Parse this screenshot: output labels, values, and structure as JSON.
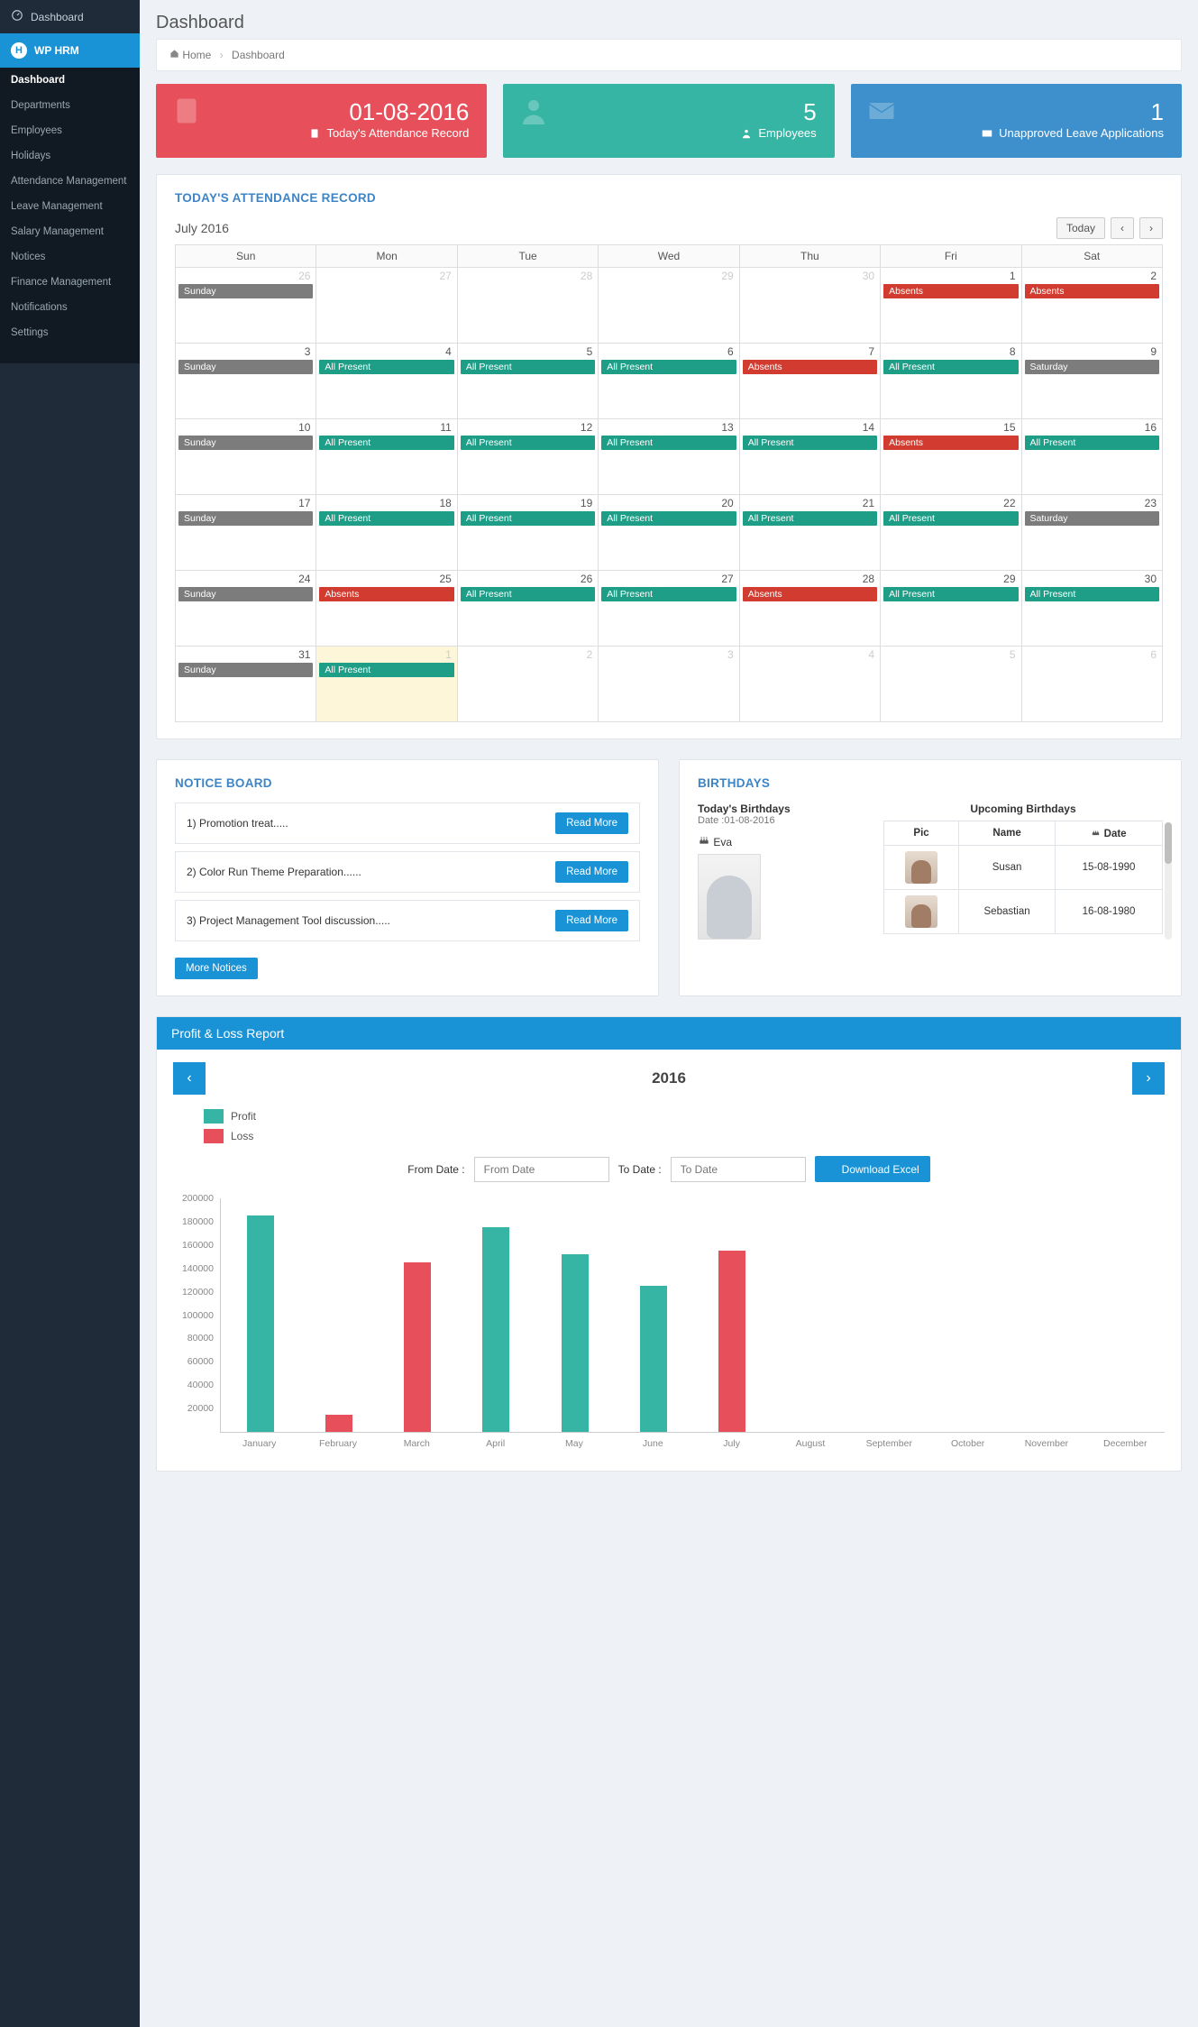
{
  "sidebar": {
    "top_dashboard": "Dashboard",
    "app_name": "WP HRM",
    "nav": [
      "Dashboard",
      "Departments",
      "Employees",
      "Holidays",
      "Attendance Management",
      "Leave Management",
      "Salary Management",
      "Notices",
      "Finance Management",
      "Notifications",
      "Settings"
    ]
  },
  "page": {
    "title": "Dashboard"
  },
  "breadcrumb": {
    "home": "Home",
    "current": "Dashboard"
  },
  "stats": {
    "record": {
      "value": "01-08-2016",
      "label": "Today's Attendance Record"
    },
    "employees": {
      "value": "5",
      "label": "Employees"
    },
    "leave": {
      "value": "1",
      "label": "Unapproved Leave Applications"
    }
  },
  "attendance": {
    "heading": "TODAY'S ATTENDANCE RECORD",
    "month_label": "July 2016",
    "today_btn": "Today",
    "dow": [
      "Sun",
      "Mon",
      "Tue",
      "Wed",
      "Thu",
      "Fri",
      "Sat"
    ],
    "labels": {
      "sunday": "Sunday",
      "saturday": "Saturday",
      "all_present": "All Present",
      "absents": "Absents"
    },
    "weeks": [
      [
        {
          "n": 26,
          "other": true,
          "b": [
            {
              "t": "sunday",
              "c": "grey"
            }
          ]
        },
        {
          "n": 27,
          "other": true
        },
        {
          "n": 28,
          "other": true
        },
        {
          "n": 29,
          "other": true
        },
        {
          "n": 30,
          "other": true
        },
        {
          "n": 1,
          "b": [
            {
              "t": "absents",
              "c": "red"
            }
          ]
        },
        {
          "n": 2,
          "b": [
            {
              "t": "absents",
              "c": "red"
            }
          ]
        }
      ],
      [
        {
          "n": 3,
          "b": [
            {
              "t": "sunday",
              "c": "grey"
            }
          ]
        },
        {
          "n": 4,
          "b": [
            {
              "t": "all_present",
              "c": "green"
            }
          ]
        },
        {
          "n": 5,
          "b": [
            {
              "t": "all_present",
              "c": "green"
            }
          ]
        },
        {
          "n": 6,
          "b": [
            {
              "t": "all_present",
              "c": "green"
            }
          ]
        },
        {
          "n": 7,
          "b": [
            {
              "t": "absents",
              "c": "red"
            }
          ]
        },
        {
          "n": 8,
          "b": [
            {
              "t": "all_present",
              "c": "green"
            }
          ]
        },
        {
          "n": 9,
          "b": [
            {
              "t": "saturday",
              "c": "grey"
            }
          ]
        }
      ],
      [
        {
          "n": 10,
          "b": [
            {
              "t": "sunday",
              "c": "grey"
            }
          ]
        },
        {
          "n": 11,
          "b": [
            {
              "t": "all_present",
              "c": "green"
            }
          ]
        },
        {
          "n": 12,
          "b": [
            {
              "t": "all_present",
              "c": "green"
            }
          ]
        },
        {
          "n": 13,
          "b": [
            {
              "t": "all_present",
              "c": "green"
            }
          ]
        },
        {
          "n": 14,
          "b": [
            {
              "t": "all_present",
              "c": "green"
            }
          ]
        },
        {
          "n": 15,
          "b": [
            {
              "t": "absents",
              "c": "red"
            }
          ]
        },
        {
          "n": 16,
          "b": [
            {
              "t": "all_present",
              "c": "green"
            }
          ]
        }
      ],
      [
        {
          "n": 17,
          "b": [
            {
              "t": "sunday",
              "c": "grey"
            }
          ]
        },
        {
          "n": 18,
          "b": [
            {
              "t": "all_present",
              "c": "green"
            }
          ]
        },
        {
          "n": 19,
          "b": [
            {
              "t": "all_present",
              "c": "green"
            }
          ]
        },
        {
          "n": 20,
          "b": [
            {
              "t": "all_present",
              "c": "green"
            }
          ]
        },
        {
          "n": 21,
          "b": [
            {
              "t": "all_present",
              "c": "green"
            }
          ]
        },
        {
          "n": 22,
          "b": [
            {
              "t": "all_present",
              "c": "green"
            }
          ]
        },
        {
          "n": 23,
          "b": [
            {
              "t": "saturday",
              "c": "grey"
            }
          ]
        }
      ],
      [
        {
          "n": 24,
          "b": [
            {
              "t": "sunday",
              "c": "grey"
            }
          ]
        },
        {
          "n": 25,
          "b": [
            {
              "t": "absents",
              "c": "red"
            }
          ]
        },
        {
          "n": 26,
          "b": [
            {
              "t": "all_present",
              "c": "green"
            }
          ]
        },
        {
          "n": 27,
          "b": [
            {
              "t": "all_present",
              "c": "green"
            }
          ]
        },
        {
          "n": 28,
          "b": [
            {
              "t": "absents",
              "c": "red"
            }
          ]
        },
        {
          "n": 29,
          "b": [
            {
              "t": "all_present",
              "c": "green"
            }
          ]
        },
        {
          "n": 30,
          "b": [
            {
              "t": "all_present",
              "c": "green"
            }
          ]
        }
      ],
      [
        {
          "n": 31,
          "b": [
            {
              "t": "sunday",
              "c": "grey"
            }
          ]
        },
        {
          "n": 1,
          "other": true,
          "today": true,
          "b": [
            {
              "t": "all_present",
              "c": "green"
            }
          ]
        },
        {
          "n": 2,
          "other": true
        },
        {
          "n": 3,
          "other": true
        },
        {
          "n": 4,
          "other": true
        },
        {
          "n": 5,
          "other": true
        },
        {
          "n": 6,
          "other": true
        }
      ]
    ]
  },
  "notices": {
    "heading": "NOTICE BOARD",
    "items": [
      "1) Promotion treat.....",
      "2) Color Run Theme Preparation......",
      "3) Project Management Tool discussion....."
    ],
    "read_more": "Read More",
    "more": "More Notices"
  },
  "birthdays": {
    "heading": "BIRTHDAYS",
    "today_hd": "Today's Birthdays",
    "today_date": "Date :01-08-2016",
    "today_name": "Eva",
    "upcoming_hd": "Upcoming Birthdays",
    "cols": {
      "pic": "Pic",
      "name": "Name",
      "date": "Date"
    },
    "rows": [
      {
        "name": "Susan",
        "date": "15-08-1990"
      },
      {
        "name": "Sebastian",
        "date": "16-08-1980"
      }
    ]
  },
  "pl": {
    "heading": "Profit & Loss Report",
    "year": "2016",
    "legend": {
      "profit": "Profit",
      "loss": "Loss"
    },
    "from_lbl": "From Date :",
    "to_lbl": "To Date :",
    "from_ph": "From Date",
    "to_ph": "To Date",
    "download": "Download Excel"
  },
  "chart_data": {
    "type": "bar",
    "y_ticks": [
      20000,
      40000,
      60000,
      80000,
      100000,
      120000,
      140000,
      160000,
      180000,
      200000
    ],
    "ymax": 200000,
    "categories": [
      "January",
      "February",
      "March",
      "April",
      "May",
      "June",
      "July",
      "August",
      "September",
      "October",
      "November",
      "December"
    ],
    "series": [
      {
        "name": "Profit",
        "color": "#36b5a4",
        "values": [
          185000,
          null,
          null,
          175000,
          152000,
          125000,
          null,
          null,
          null,
          null,
          null,
          null
        ]
      },
      {
        "name": "Loss",
        "color": "#e7505a",
        "values": [
          null,
          15000,
          145000,
          null,
          null,
          null,
          155000,
          null,
          null,
          null,
          null,
          null
        ]
      }
    ]
  }
}
